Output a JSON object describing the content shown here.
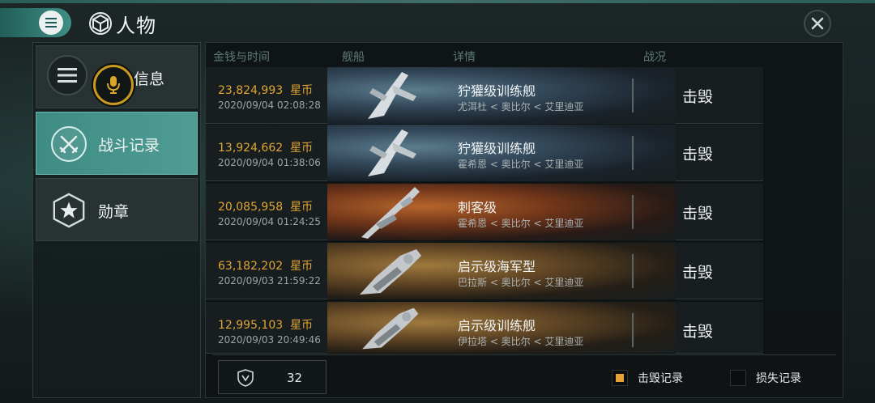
{
  "header": {
    "title": "人物",
    "icons": {
      "menu": "hamburger-icon",
      "title": "cube-icon",
      "close": "close-icon"
    }
  },
  "sidebar": {
    "items": [
      {
        "label": "信息",
        "icon": "hamburger-icon",
        "active": false
      },
      {
        "label": "战斗记录",
        "icon": "crossed-swords-icon",
        "active": true
      },
      {
        "label": "勋章",
        "icon": "star-badge-icon",
        "active": false
      }
    ],
    "mic_icon": "microphone-icon"
  },
  "table": {
    "headers": {
      "money_time": "金钱与时间",
      "ship": "舰船",
      "details": "详情",
      "status": "战况"
    },
    "rows": [
      {
        "amount": "23,824,993",
        "currency": "星币",
        "time": "2020/09/04  02:08:28",
        "ship_name": "狞獾级训练舰",
        "location": "尤洱杜 < 奥比尔 < 艾里迪亚",
        "result": "击毁",
        "theme": "blue"
      },
      {
        "amount": "13,924,662",
        "currency": "星币",
        "time": "2020/09/04  01:38:06",
        "ship_name": "狞獾级训练舰",
        "location": "霍希恩 < 奥比尔 < 艾里迪亚",
        "result": "击毁",
        "theme": "blue"
      },
      {
        "amount": "20,085,958",
        "currency": "星币",
        "time": "2020/09/04  01:24:25",
        "ship_name": "刺客级",
        "location": "霍希恩 < 奥比尔 < 艾里迪亚",
        "result": "击毁",
        "theme": "red"
      },
      {
        "amount": "63,182,202",
        "currency": "星币",
        "time": "2020/09/03  21:59:22",
        "ship_name": "启示级海军型",
        "location": "巴拉斯 < 奥比尔 < 艾里迪亚",
        "result": "击毁",
        "theme": "gold"
      },
      {
        "amount": "12,995,103",
        "currency": "星币",
        "time": "2020/09/03  20:49:46",
        "ship_name": "启示级训练舰",
        "location": "伊拉塔 < 奥比尔 < 艾里迪亚",
        "result": "击毁",
        "theme": "gold"
      }
    ]
  },
  "footer": {
    "count": "32",
    "count_icon": "shield-icon",
    "legend_kill": "击毁记录",
    "legend_loss": "损失记录",
    "colors": {
      "kill": "#e6a234",
      "loss": "#0b0e0e"
    }
  }
}
